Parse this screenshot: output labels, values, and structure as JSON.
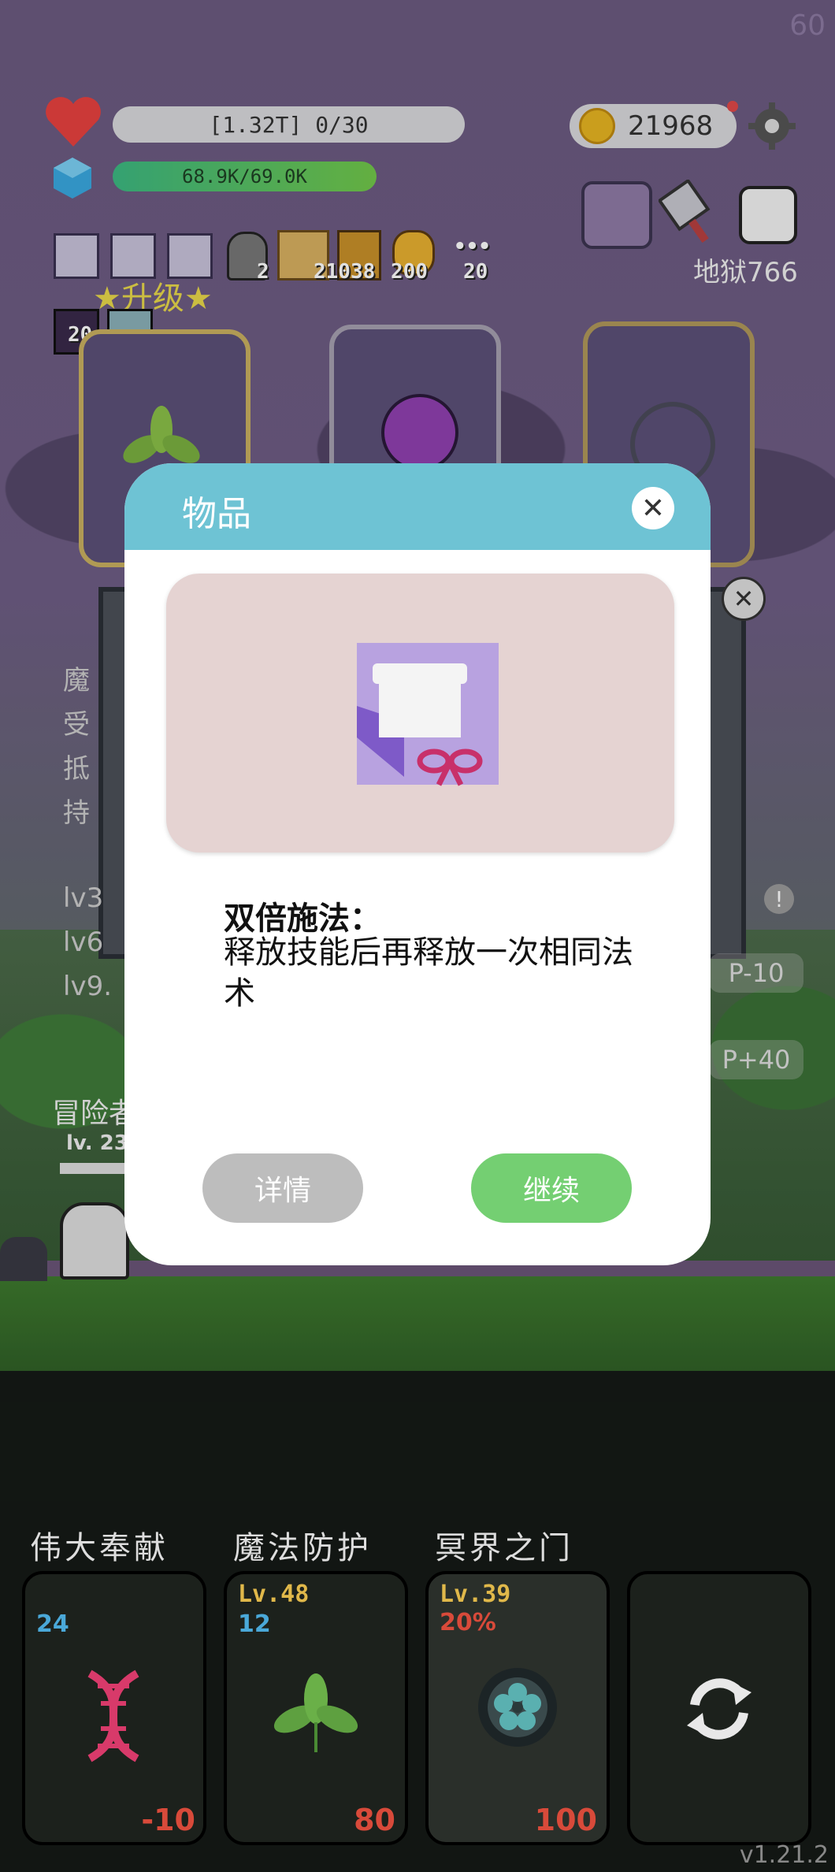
{
  "fps": "60",
  "hud": {
    "hp_text": "[1.32T] 0/30",
    "mp_text": "68.9K/69.0K",
    "coins": "21968",
    "hell_level": "地狱766"
  },
  "inventory_counts": {
    "helmet": "2",
    "scroll_book": "21038",
    "pineapple": "200",
    "dots": "20",
    "gem_slot": "20"
  },
  "upgrade_label": "★升级★",
  "behind_text": {
    "lines": [
      "魔",
      "受",
      "抵",
      "持",
      "lv3",
      "lv6",
      "lv9."
    ],
    "adventurer": "冒险者",
    "adventurer_lv": "lv. 23",
    "mp_minus": "P-10",
    "mp_plus": "P+40"
  },
  "modal": {
    "title": "物品",
    "item_name": "双倍施法：",
    "item_desc": "释放技能后再释放一次相同法术",
    "detail_button": "详情",
    "continue_button": "继续"
  },
  "skills": [
    {
      "title": "伟大奉献",
      "level": "",
      "top_num": "24",
      "top_color": "blue",
      "bottom": "-10",
      "icon": "dna-icon"
    },
    {
      "title": "魔法防护",
      "level": "Lv.48",
      "top_num": "12",
      "top_color": "blue",
      "bottom": "80",
      "icon": "leaf-icon"
    },
    {
      "title": "冥界之门",
      "level": "Lv.39",
      "top_num": "20%",
      "top_color": "red",
      "bottom": "100",
      "icon": "portal-flower-icon"
    },
    {
      "title": "",
      "level": "",
      "top_num": "",
      "top_color": "",
      "bottom": "",
      "icon": "refresh-icon"
    }
  ],
  "version": "v1.21.2",
  "colors": {
    "modal_header": "#6ec3d4",
    "continue": "#74cf72",
    "detail": "#bdbdbd"
  }
}
